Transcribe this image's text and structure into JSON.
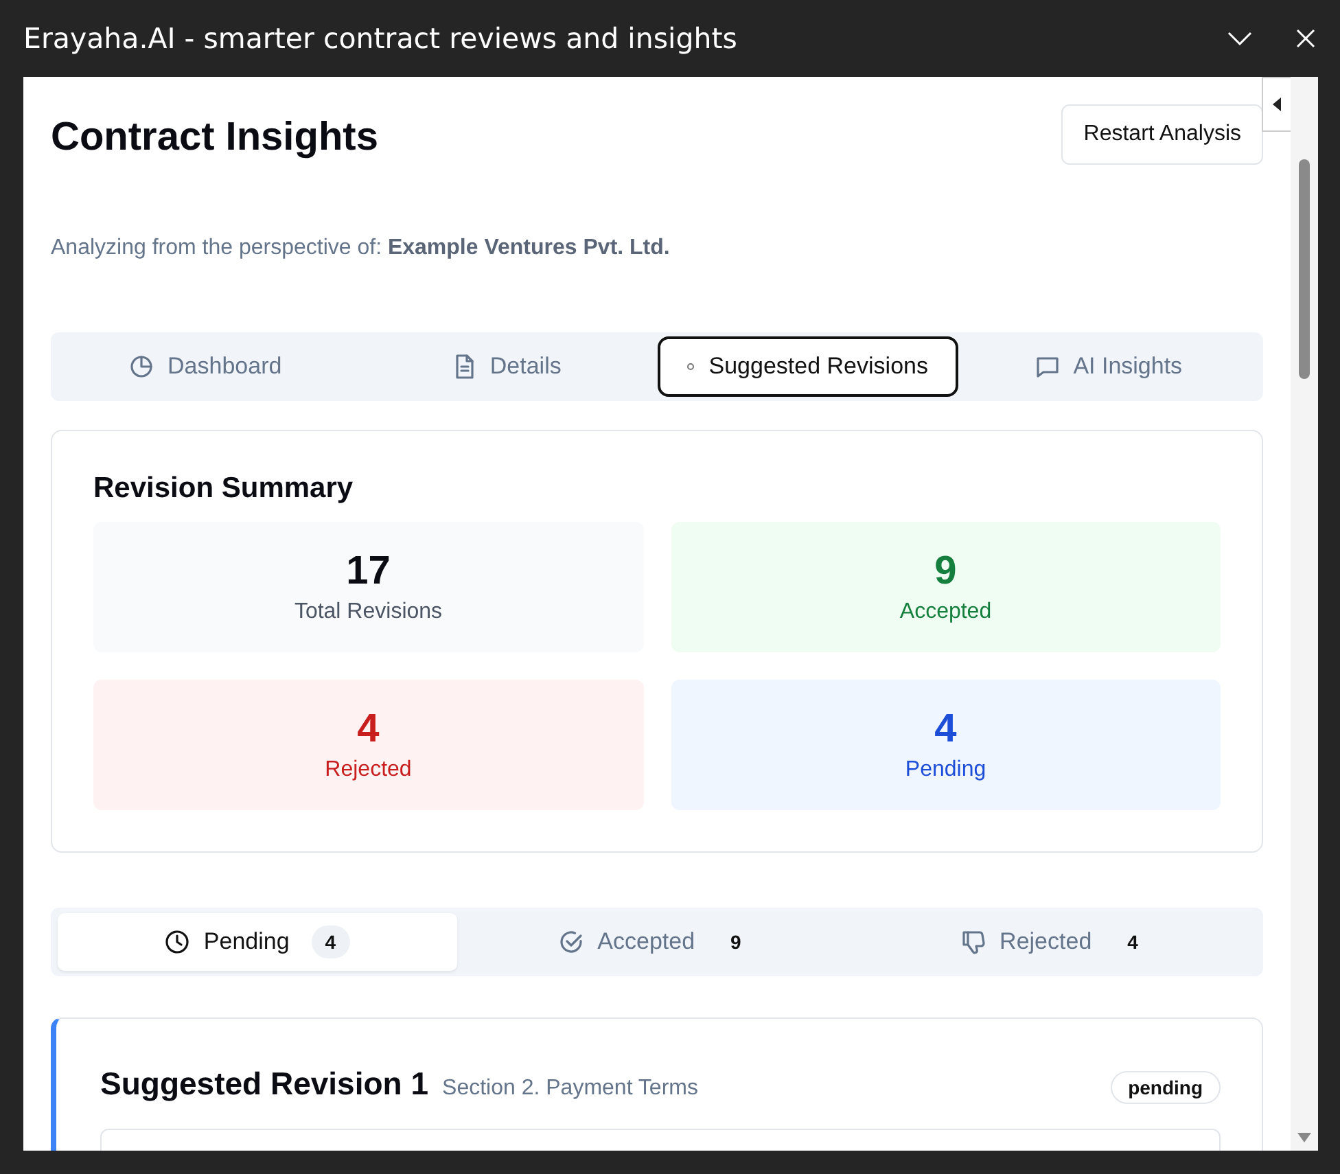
{
  "window": {
    "title": "Erayaha.AI - smarter contract reviews and insights"
  },
  "header": {
    "title": "Contract Insights",
    "button": "Restart Analysis"
  },
  "perspective": {
    "label": "Analyzing from the perspective of:",
    "party": "Example Ventures Pvt. Ltd."
  },
  "tabs": [
    {
      "label": "Dashboard",
      "kind": "pie",
      "selected": false
    },
    {
      "label": "Details",
      "kind": "document",
      "selected": false
    },
    {
      "label": "Suggested Revisions",
      "kind": "dot",
      "selected": true
    },
    {
      "label": "AI Insights",
      "kind": "chat",
      "selected": false
    }
  ],
  "summary": {
    "title": "Revision Summary",
    "stats": [
      {
        "value": "17",
        "label": "Total Revisions",
        "kind": "neutral"
      },
      {
        "value": "9",
        "label": "Accepted",
        "kind": "green"
      },
      {
        "value": "4",
        "label": "Rejected",
        "kind": "red"
      },
      {
        "value": "4",
        "label": "Pending",
        "kind": "blue"
      }
    ]
  },
  "filters": [
    {
      "label": "Pending",
      "kind": "clock",
      "count": "4",
      "selected": true
    },
    {
      "label": "Accepted",
      "kind": "check",
      "count": "9",
      "selected": false
    },
    {
      "label": "Rejected",
      "kind": "thumbdown",
      "count": "4",
      "selected": false
    }
  ],
  "revision": {
    "title": "Suggested Revision 1",
    "section": "Section 2. Payment Terms",
    "status": "pending"
  }
}
